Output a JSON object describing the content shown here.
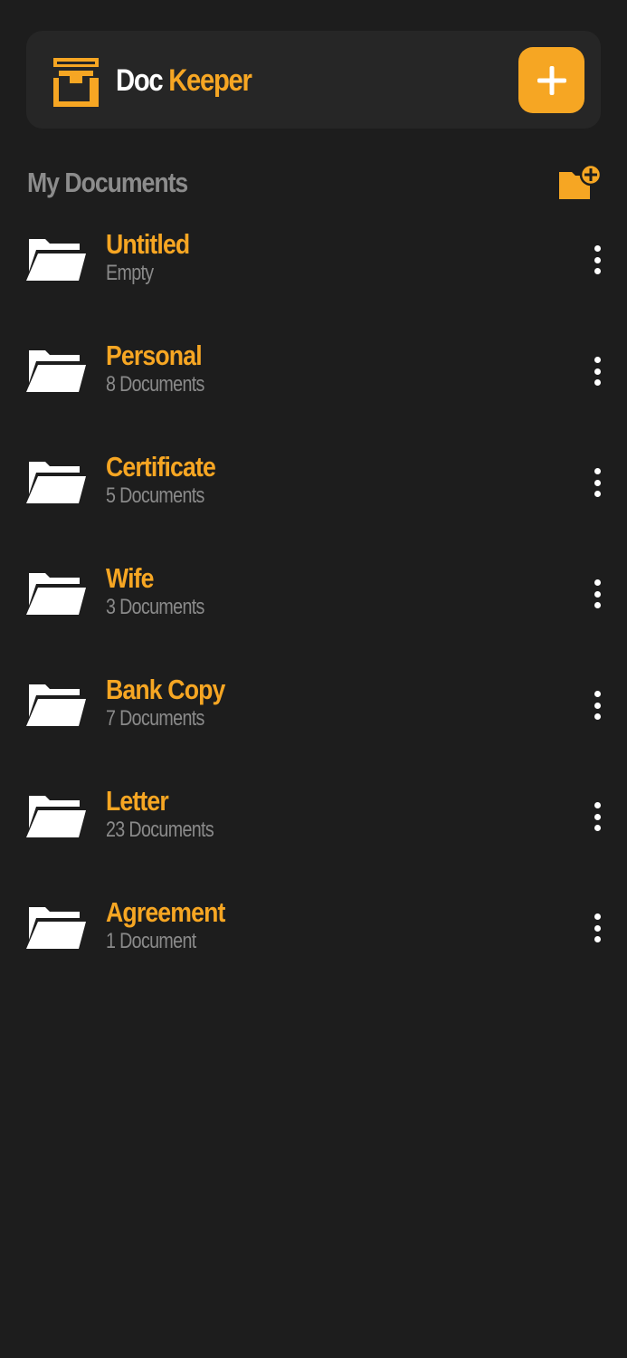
{
  "header": {
    "title_part1": "Doc",
    "title_part2": "Keeper",
    "logo_icon": "doc-keeper-logo-icon",
    "add_icon": "plus-icon"
  },
  "section": {
    "title": "My Documents",
    "new_folder_icon": "folder-plus-icon"
  },
  "folders": [
    {
      "name": "Untitled",
      "count": "Empty"
    },
    {
      "name": "Personal",
      "count": "8 Documents"
    },
    {
      "name": "Certificate",
      "count": "5 Documents"
    },
    {
      "name": "Wife",
      "count": "3 Documents"
    },
    {
      "name": "Bank Copy",
      "count": "7 Documents"
    },
    {
      "name": "Letter",
      "count": "23 Documents"
    },
    {
      "name": "Agreement",
      "count": "1 Document"
    }
  ],
  "colors": {
    "background": "#1d1d1d",
    "card": "#262626",
    "accent": "#f6a623",
    "muted_text": "#8a8a8a",
    "white": "#ffffff"
  }
}
